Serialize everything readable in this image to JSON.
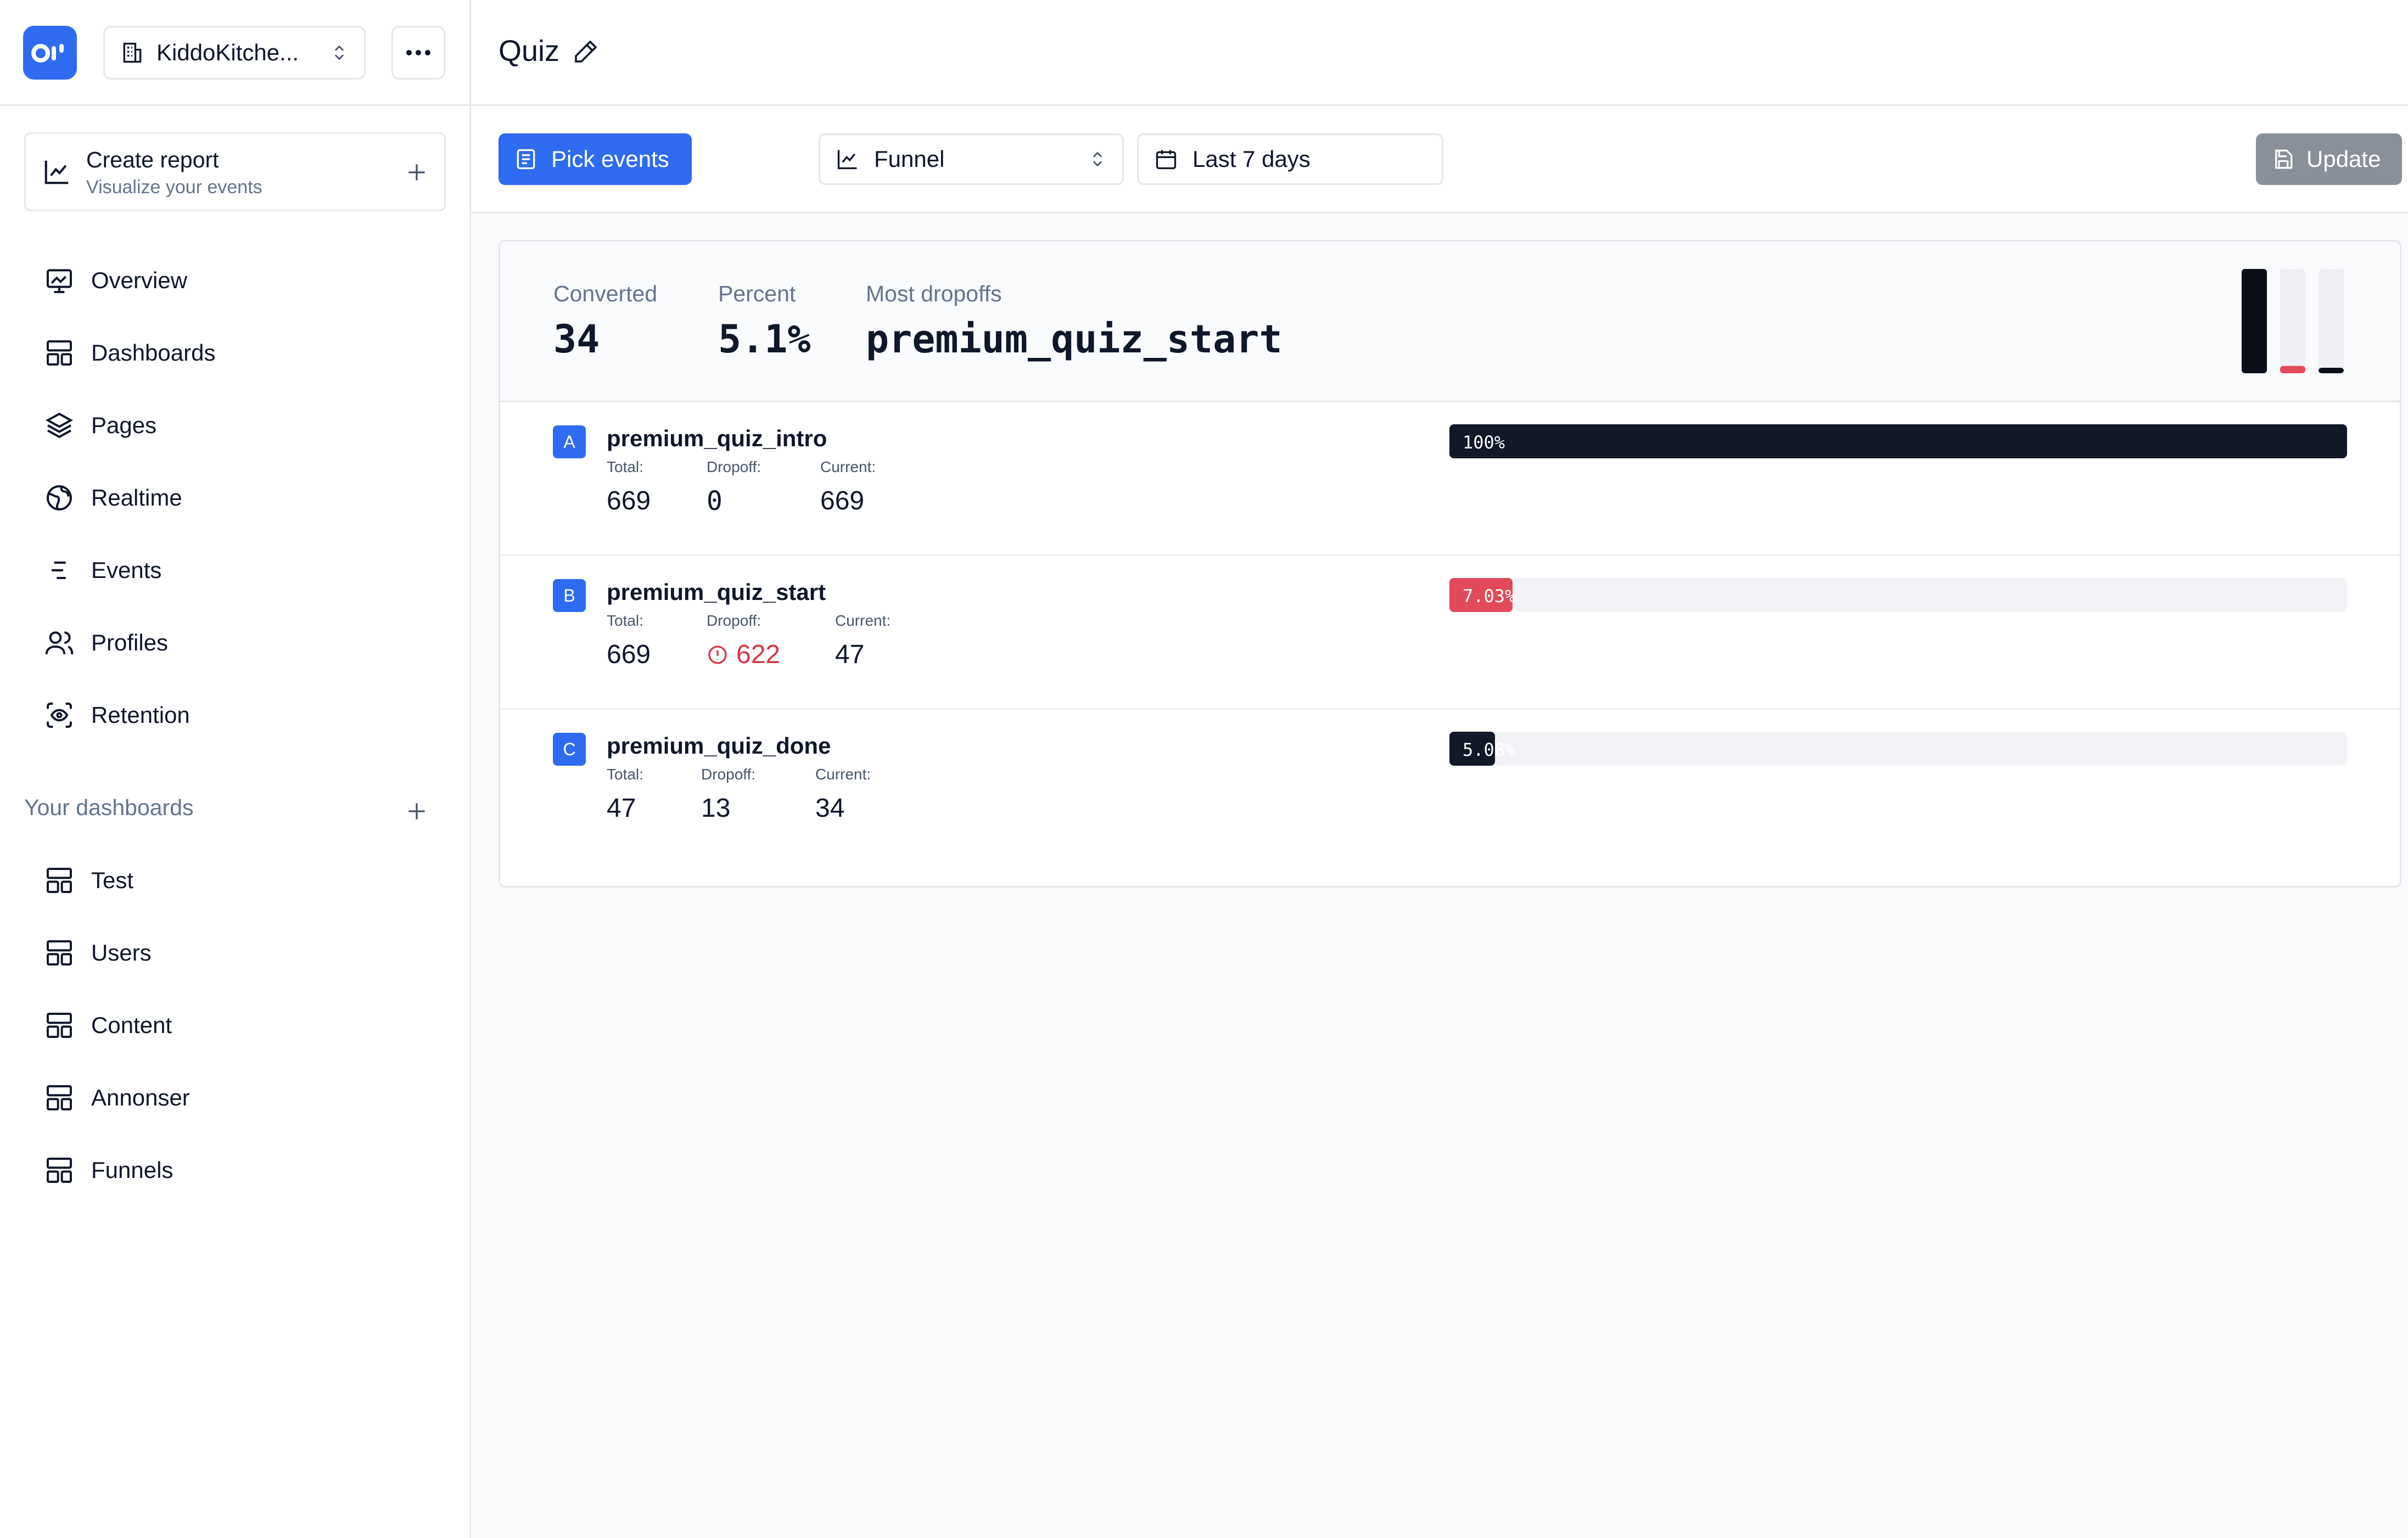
{
  "sidebar": {
    "logo_text": "OP",
    "project_name": "KiddoKitche...",
    "create_report": {
      "title": "Create report",
      "subtitle": "Visualize your events"
    },
    "nav": [
      {
        "label": "Overview",
        "icon": "monitor-chart-icon"
      },
      {
        "label": "Dashboards",
        "icon": "layout-grid-icon"
      },
      {
        "label": "Pages",
        "icon": "layers-icon"
      },
      {
        "label": "Realtime",
        "icon": "globe-icon"
      },
      {
        "label": "Events",
        "icon": "list-icon"
      },
      {
        "label": "Profiles",
        "icon": "users-icon"
      },
      {
        "label": "Retention",
        "icon": "scan-eye-icon"
      }
    ],
    "dashboards_label": "Your dashboards",
    "dashboards": [
      {
        "label": "Test"
      },
      {
        "label": "Users"
      },
      {
        "label": "Content"
      },
      {
        "label": "Annonser"
      },
      {
        "label": "Funnels"
      }
    ]
  },
  "header": {
    "title": "Quiz"
  },
  "toolbar": {
    "pick_events_label": "Pick events",
    "chart_type_label": "Funnel",
    "date_range_label": "Last 7 days",
    "update_label": "Update"
  },
  "summary": {
    "converted_label": "Converted",
    "converted_value": "34",
    "percent_label": "Percent",
    "percent_value": "5.1%",
    "most_dropoffs_label": "Most dropoffs",
    "most_dropoffs_value": "premium_quiz_start"
  },
  "steps": [
    {
      "letter": "A",
      "name": "premium_quiz_intro",
      "total_label": "Total:",
      "total": "669",
      "dropoff_label": "Dropoff:",
      "dropoff": "0",
      "current_label": "Current:",
      "current": "669",
      "bar_label": "100%",
      "bar_percent": 100,
      "bar_color": "#111827"
    },
    {
      "letter": "B",
      "name": "premium_quiz_start",
      "total_label": "Total:",
      "total": "669",
      "dropoff_label": "Dropoff:",
      "dropoff": "622",
      "current_label": "Current:",
      "current": "47",
      "bar_label": "7.03%",
      "bar_percent": 7.03,
      "bar_color": "#e04a5a"
    },
    {
      "letter": "C",
      "name": "premium_quiz_done",
      "total_label": "Total:",
      "total": "47",
      "dropoff_label": "Dropoff:",
      "dropoff": "13",
      "current_label": "Current:",
      "current": "34",
      "bar_label": "5.08%",
      "bar_percent": 5.08,
      "bar_color": "#111827"
    }
  ],
  "mini_bars": [
    {
      "percent": 100,
      "color": "#0b0f19"
    },
    {
      "percent": 7.03,
      "color": "#e04a5a"
    },
    {
      "percent": 5.08,
      "color": "#0b0f19"
    }
  ],
  "colors": {
    "accent": "#2f6bf0",
    "danger": "#dc3545",
    "muted_button": "#8a9099"
  }
}
